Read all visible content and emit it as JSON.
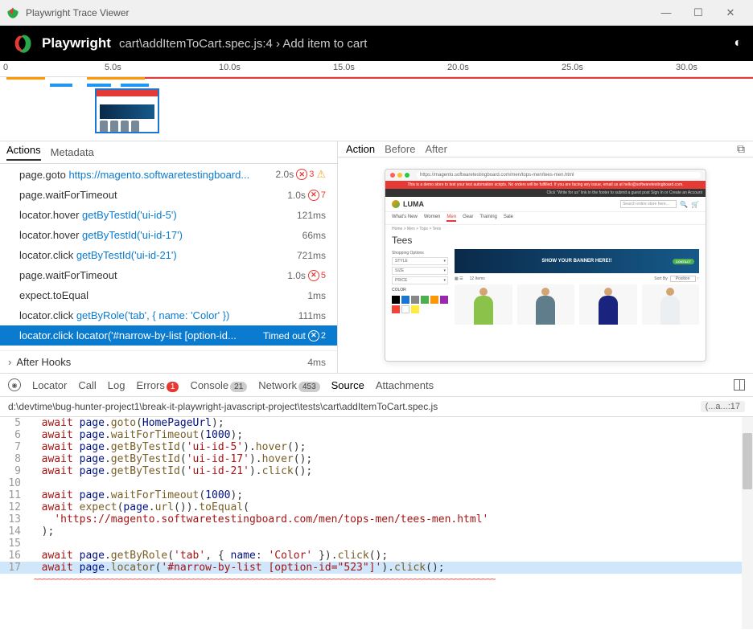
{
  "titlebar": {
    "text": "Playwright Trace Viewer"
  },
  "header": {
    "title": "Playwright",
    "breadcrumb": "cart\\addItemToCart.spec.js:4 › Add item to cart"
  },
  "timeline": {
    "ticks": [
      "0",
      "5.0s",
      "10.0s",
      "15.0s",
      "20.0s",
      "25.0s",
      "30.0s"
    ]
  },
  "leftTabs": {
    "actions": "Actions",
    "metadata": "Metadata"
  },
  "actions": [
    {
      "name": "page.goto",
      "link": "https://magento.softwaretestingboard...",
      "time": "2.0s",
      "err": true,
      "count": "3",
      "warn": true
    },
    {
      "name": "page.waitForTimeout",
      "link": "",
      "time": "1.0s",
      "err": true,
      "count": "7"
    },
    {
      "name": "locator.hover",
      "link": "getByTestId('ui-id-5')",
      "time": "121ms"
    },
    {
      "name": "locator.hover",
      "link": "getByTestId('ui-id-17')",
      "time": "66ms"
    },
    {
      "name": "locator.click",
      "link": "getByTestId('ui-id-21')",
      "time": "721ms"
    },
    {
      "name": "page.waitForTimeout",
      "link": "",
      "time": "1.0s",
      "err": true,
      "count": "5"
    },
    {
      "name": "expect.toEqual",
      "link": "",
      "time": "1ms"
    },
    {
      "name": "locator.click",
      "link": "getByRole('tab', { name: 'Color' })",
      "time": "111ms"
    },
    {
      "name": "locator.click",
      "link": "locator('#narrow-by-list [option-id...",
      "time": "Timed out",
      "err": true,
      "count": "2",
      "selected": true
    }
  ],
  "afterHooks": {
    "label": "After Hooks",
    "time": "4ms"
  },
  "rightTabs": {
    "action": "Action",
    "before": "Before",
    "after": "After"
  },
  "snapshot": {
    "url": "https://magento.softwaretestingboard.com/men/tops-men/tees-men.html",
    "redbar": "This is a demo store to test your test automation scripts. No orders will be fulfilled. If you are facing any issue, email us at hello@softwaretestingboard.com.",
    "blackbar": "Click \"Write for us\" link in the footer to submit a guest post   Sign In  or  Create an Account",
    "brand": "LUMA",
    "searchPlaceholder": "Search entire store here...",
    "nav": [
      "What's New",
      "Women",
      "Men",
      "Gear",
      "Training",
      "Sale"
    ],
    "crumbs": "Home  >  Men  >  Tops  >  Tees",
    "h1": "Tees",
    "shopOptions": "Shopping Options",
    "opts": [
      "STYLE",
      "SIZE",
      "PRICE",
      "COLOR"
    ],
    "bannerText": "SHOW YOUR BANNER HERE!!",
    "bannerBtn": "CONTACT",
    "itemsCount": "12 Items",
    "sortLabel": "Sort By",
    "sortValue": "Position"
  },
  "bottomTabs": {
    "locator": "Locator",
    "call": "Call",
    "log": "Log",
    "errors": "Errors",
    "errorsCount": "1",
    "console": "Console",
    "consoleCount": "21",
    "network": "Network",
    "networkCount": "453",
    "source": "Source",
    "attachments": "Attachments"
  },
  "path": "d:\\devtime\\bug-hunter-project1\\break-it-playwright-javascript-project\\tests\\cart\\addItemToCart.spec.js",
  "rightBadge": "(...a...:17",
  "code": {
    "l5": "  await page.goto(HomePageUrl);",
    "l6": "  await page.waitForTimeout(1000);",
    "l7": "  await page.getByTestId('ui-id-5').hover();",
    "l8": "  await page.getByTestId('ui-id-17').hover();",
    "l9": "  await page.getByTestId('ui-id-21').click();",
    "l11": "  await page.waitForTimeout(1000);",
    "l12": "  await expect(page.url()).toEqual(",
    "l13": "    'https://magento.softwaretestingboard.com/men/tops-men/tees-men.html'",
    "l14": "  );",
    "l16": "  await page.getByRole('tab', { name: 'Color' }).click();",
    "l17": "  await page.locator('#narrow-by-list [option-id=\"523\"]').click();"
  }
}
